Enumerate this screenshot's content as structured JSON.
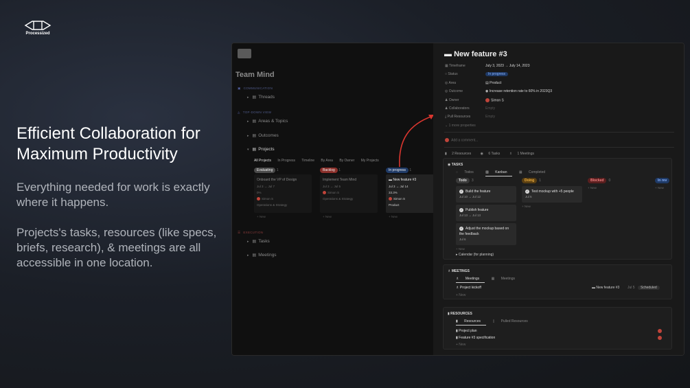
{
  "brand": {
    "name": "Processized"
  },
  "hero": {
    "title": "Efficient Collaboration for Maximum Productivity",
    "para1": "Everything needed for work is exactly where it happens.",
    "para2": "Projects's tasks, resources (like specs, briefs, research), & meetings are all accessible in one location."
  },
  "left": {
    "title": "Team Mind",
    "sec_communication": "COMMUNICATION",
    "threads": "Threads",
    "sec_topdown": "TOP-DOWN VIEW",
    "areas": "Areas & Topics",
    "outcomes": "Outcomes",
    "projects": "Projects",
    "tabs": [
      "All Projects",
      "In Progress",
      "Timeline",
      "By Area",
      "By Owner",
      "My Projects"
    ],
    "columns": [
      {
        "name": "Evaluating",
        "count": "1",
        "color": "#4a4a4a"
      },
      {
        "name": "Backlog",
        "count": "1",
        "color": "#8a2f2a"
      },
      {
        "name": "In progress",
        "count": "1",
        "color": "#1f3a66"
      }
    ],
    "cards": [
      {
        "title": "Onboard the VP of Design",
        "dates": "Jul 3 → Jul 7",
        "pct": "0%",
        "owner": "Simon S",
        "area": "Operations & Strategy"
      },
      {
        "title": "Implement Team Mind",
        "dates": "Jul 3 → Jul 5",
        "pct": "",
        "owner": "Simon S",
        "area": "Operations & Strategy"
      },
      {
        "title": "New feature #3",
        "dates": "Jul 3 → Jul 14",
        "pct": "33.3%",
        "owner": "Simon S",
        "area": "Product"
      }
    ],
    "new_label": "+ New",
    "sec_execution": "EXECUTION",
    "tasks": "Tasks",
    "meetings": "Meetings"
  },
  "right": {
    "title": "New feature #3",
    "props": [
      {
        "label": "Timeframe",
        "value": "July 3, 2023 → July 14, 2023"
      },
      {
        "label": "Status",
        "value": "In progress"
      },
      {
        "label": "Area",
        "value": "Product"
      },
      {
        "label": "Outcome",
        "value": "Increase retention rate to 60% in 2023Q3"
      },
      {
        "label": "Owner",
        "value": "Simon S"
      },
      {
        "label": "Collaborators",
        "value": "Empty"
      },
      {
        "label": "Pull Resources",
        "value": "Empty"
      }
    ],
    "more_props": "1 more properties",
    "comment_placeholder": "Add a comment...",
    "counts": {
      "resources": "2 Resources",
      "tasks": "6 Tasks",
      "meetings": "1 Meetings"
    },
    "tasks_block": {
      "heading": "TASKS",
      "tabs": [
        "Todos",
        "Kanban",
        "Completed"
      ],
      "columns": [
        {
          "name": "Todo",
          "count": "3",
          "bg": "#3a3a3a",
          "fg": "#ddd",
          "cards": [
            {
              "title": "Build the feature",
              "date": "Jul 10 → Jul 12"
            },
            {
              "title": "Publish feature",
              "date": "Jul 13 → Jul 13"
            },
            {
              "title": "Adjust the mockup based on the feedback",
              "date": "Jul 6"
            }
          ]
        },
        {
          "name": "Doing",
          "count": "1",
          "bg": "#5a3f12",
          "fg": "#f0b040",
          "cards": [
            {
              "title": "Test mockup with +5 people",
              "date": "Jul 5"
            }
          ]
        },
        {
          "name": "Blocked",
          "count": "0",
          "bg": "#5a1f1f",
          "fg": "#f08080",
          "cards": []
        },
        {
          "name": "In rev",
          "count": "",
          "bg": "#1f3a66",
          "fg": "#8ab4ff",
          "cards": []
        }
      ],
      "new_label": "+ New",
      "calendar": "Calendar (for planning)"
    },
    "meetings_block": {
      "heading": "MEETINGS",
      "tabs": [
        "Meetings",
        "Meetings"
      ],
      "row": {
        "title": "Project kickoff",
        "project": "New feature #3",
        "date": "Jul 5",
        "status": "Scheduled"
      },
      "new_label": "+ New"
    },
    "resources_block": {
      "heading": "RESOURCES",
      "tabs": [
        "Resources",
        "Pulled Resources"
      ],
      "rows": [
        "Project plan",
        "Feature #3 specification"
      ],
      "new_label": "+ New"
    }
  },
  "colors": {
    "accent_red": "#c0443a",
    "blue": "#1f3a66",
    "bg": "#141619"
  }
}
